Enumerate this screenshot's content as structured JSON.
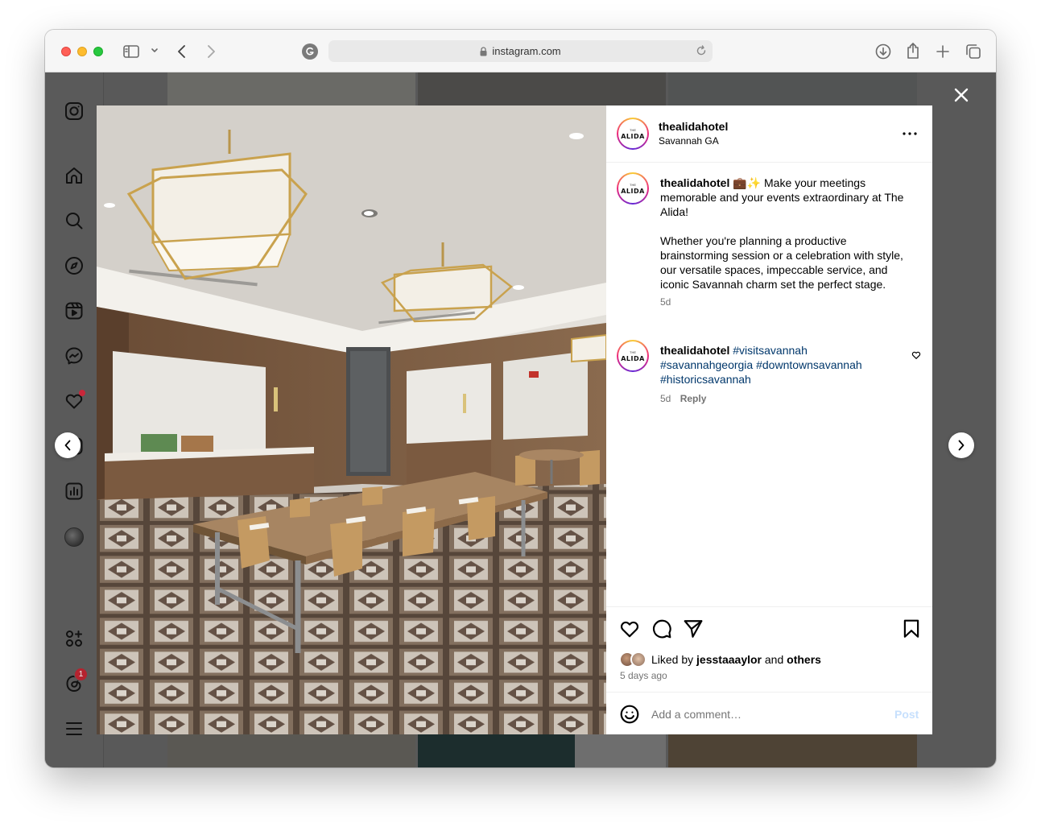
{
  "browser": {
    "url": "instagram.com"
  },
  "post": {
    "account": {
      "username": "thealidahotel",
      "location": "Savannah GA",
      "avatar_text": "ALIDA",
      "avatar_small": "THE"
    },
    "caption": {
      "username": "thealidahotel",
      "emoji": "💼✨",
      "line1": "Make your meetings memorable and your events extraordinary at The Alida!",
      "line2": "Whether you're planning a productive brainstorming session or a celebration with style, our versatile spaces, impeccable service, and iconic Savannah charm set the perfect stage.",
      "age": "5d"
    },
    "comment": {
      "username": "thealidahotel",
      "hashtags": [
        "#visitsavannah",
        "#savannahgeorgia",
        "#downtownsavannah",
        "#historicsavannah"
      ],
      "age": "5d",
      "reply_label": "Reply"
    },
    "likes": {
      "prefix": "Liked by",
      "user": "jesstaaaylor",
      "middle": "and",
      "others": "others",
      "age": "5 days ago"
    },
    "comment_box": {
      "placeholder": "Add a comment…",
      "post_label": "Post"
    }
  },
  "sidebar": {
    "notifications_badge": "1"
  },
  "colors": {
    "overlay": "#595959",
    "hashtag": "#00376b",
    "badge": "#ff3040",
    "post_disabled": "#c7e0fd"
  }
}
